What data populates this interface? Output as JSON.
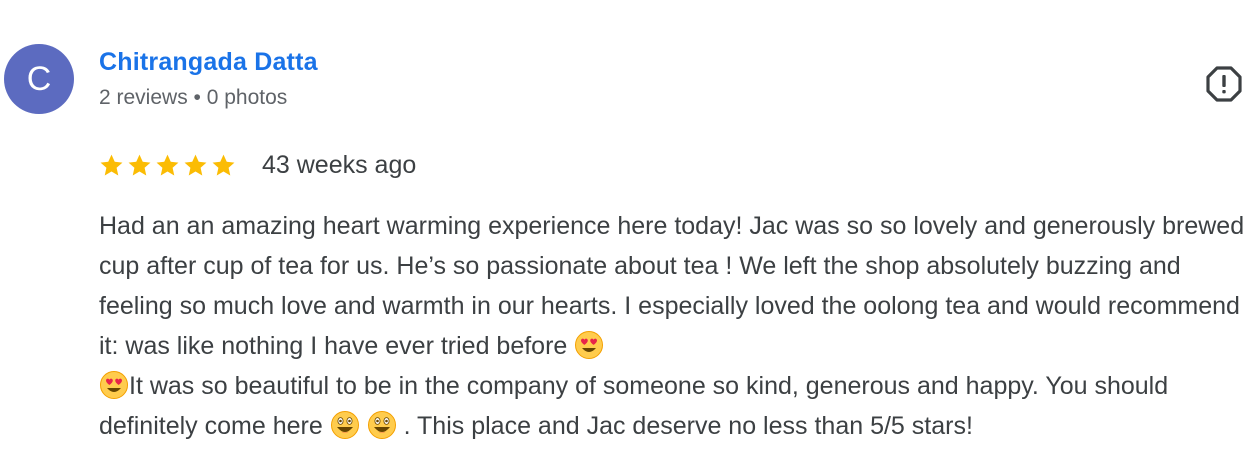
{
  "reviewer": {
    "initial": "C",
    "avatar_color": "#5c6bc0",
    "name": "Chitrangada Datta",
    "meta": "2 reviews • 0 photos"
  },
  "review": {
    "rating": 5,
    "rating_max": 5,
    "star_color": "#fbbc04",
    "time_ago": "43 weeks ago",
    "text_part1": "Had an an amazing heart warming experience here today! Jac was so so lovely and generously brewed cup after cup of tea for us. He’s so passionate about tea ! We left the shop absolutely buzzing and feeling so much love and warmth in our hearts. I especially loved the oolong tea and would recommend it: was like nothing I have ever tried before ",
    "text_part2": "It was so beautiful to be in the company of someone so kind, generous and happy. You should definitely come here ",
    "text_part3": " . This place and Jac deserve no less than 5/5 stars!"
  },
  "icons": {
    "flag": "report-flag-icon",
    "star": "star-icon",
    "heart_eyes": "heart-eyes-emoji",
    "grinning": "grinning-emoji"
  },
  "colors": {
    "name_link": "#1a73e8",
    "meta_text": "#5f6368",
    "body_text": "#3c4043"
  }
}
